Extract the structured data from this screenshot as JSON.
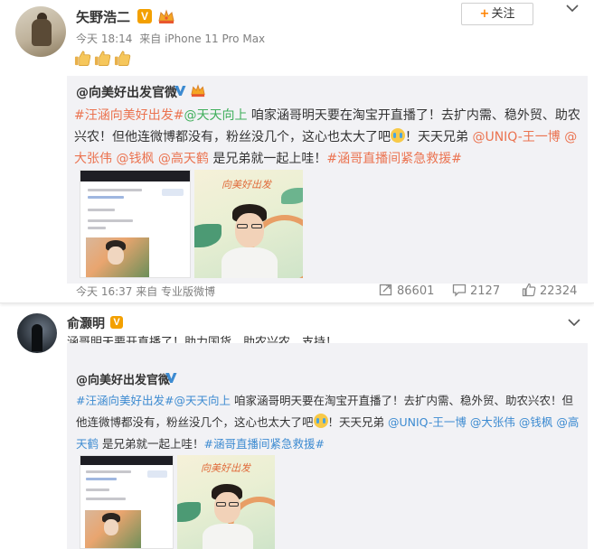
{
  "post1": {
    "user_name": "矢野浩二",
    "follow_label": "关注",
    "follow_plus": "+",
    "time": "今天 18:14",
    "source_prefix": "来自",
    "source": "iPhone 11 Pro Max",
    "thumbs": [
      "thumbs-up-emoji",
      "thumbs-up-emoji",
      "thumbs-up-emoji"
    ],
    "original": {
      "user_name": "@向美好出发官微",
      "text_parts": [
        {
          "kind": "tag",
          "text": "#汪涵向美好出发#"
        },
        {
          "kind": "tag-green",
          "text": "@天天向上"
        },
        {
          "kind": "text",
          "text": " 咱家涵哥明天要在淘宝开直播了！去扩内需、稳外贸、助农兴农！但他连微博都没有，粉丝没几个，这心也太大了吧"
        },
        {
          "kind": "emoji",
          "text": ""
        },
        {
          "kind": "text",
          "text": "！天天兄弟 "
        },
        {
          "kind": "at",
          "text": "@UNIQ-王一博"
        },
        {
          "kind": "text",
          "text": " "
        },
        {
          "kind": "at",
          "text": "@大张伟"
        },
        {
          "kind": "text",
          "text": " "
        },
        {
          "kind": "at",
          "text": "@钱枫"
        },
        {
          "kind": "text",
          "text": " "
        },
        {
          "kind": "at",
          "text": "@高天鹤"
        },
        {
          "kind": "text",
          "text": " 是兄弟就一起上哇！"
        },
        {
          "kind": "tag",
          "text": "#涵哥直播间紧急救援#"
        }
      ],
      "poster_script": "向美好出发"
    },
    "footer": {
      "time": "今天 16:37 来自 专业版微博",
      "forward_count": "86601",
      "comment_count": "2127",
      "like_count": "22324"
    }
  },
  "post2": {
    "user_name": "俞灏明",
    "text": "涵哥明天要开直播了！助力国货，助农兴农，支持！",
    "original": {
      "user_name": "@向美好出发官微",
      "text_parts": [
        {
          "kind": "tag",
          "text": "#汪涵向美好出发#"
        },
        {
          "kind": "at",
          "text": "@天天向上"
        },
        {
          "kind": "text",
          "text": " 咱家涵哥明天要在淘宝开直播了！去扩内需、稳外贸、助农兴农！但他连微博都没有，粉丝没几个，这心也太大了吧"
        },
        {
          "kind": "emoji",
          "text": ""
        },
        {
          "kind": "text",
          "text": "！天天兄弟 "
        },
        {
          "kind": "at",
          "text": "@UNIQ-王一博"
        },
        {
          "kind": "text",
          "text": " "
        },
        {
          "kind": "at",
          "text": "@大张伟"
        },
        {
          "kind": "text",
          "text": " "
        },
        {
          "kind": "at",
          "text": "@钱枫"
        },
        {
          "kind": "text",
          "text": " "
        },
        {
          "kind": "at",
          "text": "@高天鹤"
        },
        {
          "kind": "text",
          "text": " 是兄弟就一起上哇！"
        },
        {
          "kind": "tag",
          "text": "#涵哥直播间紧急救援#"
        }
      ]
    }
  },
  "colors": {
    "accent_orange": "#eb7350",
    "link_blue": "#3d8bd1",
    "verified_orange": "#f3a000",
    "follow_plus": "#ff8200"
  }
}
